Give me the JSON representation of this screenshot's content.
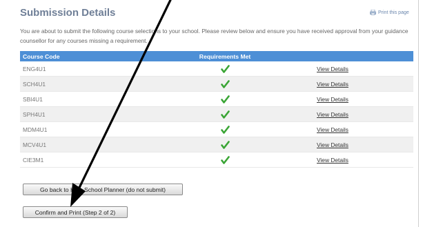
{
  "page": {
    "title": "Submission Details",
    "print_label": "Print this page",
    "intro": "You are about to submit the following course selections to your school. Please review below and ensure you have received approval from your guidance counsellor for any courses missing a requirement."
  },
  "table": {
    "headers": [
      "Course Code",
      "Requirements Met",
      ""
    ],
    "link_label": "View Details",
    "rows": [
      {
        "code": "ENG4U1",
        "met": true
      },
      {
        "code": "SCH4U1",
        "met": true
      },
      {
        "code": "SBI4U1",
        "met": true
      },
      {
        "code": "SPH4U1",
        "met": true
      },
      {
        "code": "MDM4U1",
        "met": true
      },
      {
        "code": "MCV4U1",
        "met": true
      },
      {
        "code": "CIE3M1",
        "met": true
      }
    ]
  },
  "buttons": {
    "back": "Go back to High School Planner (do not submit)",
    "confirm": "Confirm and Print (Step 2 of 2)"
  },
  "colors": {
    "header": "#4d8fd6",
    "check": "#3aa535",
    "annotation_arrow": "#000000"
  },
  "icons": {
    "print": "printer-icon",
    "check": "checkmark-icon"
  }
}
